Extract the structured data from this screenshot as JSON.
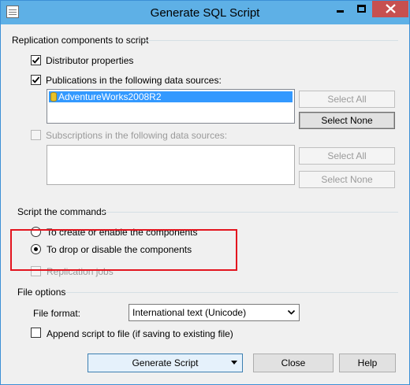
{
  "window": {
    "title": "Generate SQL Script"
  },
  "replication": {
    "section_label": "Replication components to script",
    "distributor": {
      "label": "Distributor properties",
      "checked": true
    },
    "publications": {
      "label": "Publications in the following data sources:",
      "checked": true,
      "items": [
        "AdventureWorks2008R2"
      ],
      "select_all": "Select All",
      "select_none": "Select None"
    },
    "subscriptions": {
      "label": "Subscriptions in the following data sources:",
      "checked": false,
      "enabled": false,
      "items": [],
      "select_all": "Select All",
      "select_none": "Select None"
    }
  },
  "commands": {
    "section_label": "Script the commands",
    "option_create": "To create or enable the components",
    "option_drop": "To drop or disable the components",
    "selected": "option_drop",
    "replication_jobs": {
      "label": "Replication jobs",
      "checked": false,
      "enabled": false
    }
  },
  "file_options": {
    "section_label": "File options",
    "format_label": "File format:",
    "format_value": "International text (Unicode)",
    "append_label": "Append script to file (if saving to existing file)",
    "append_checked": false
  },
  "buttons": {
    "generate": "Generate Script",
    "close": "Close",
    "help": "Help"
  },
  "colors": {
    "titlebar": "#5eb0e6",
    "close_button": "#c75050",
    "selection": "#3399ff",
    "annotation": "#e3141e"
  }
}
